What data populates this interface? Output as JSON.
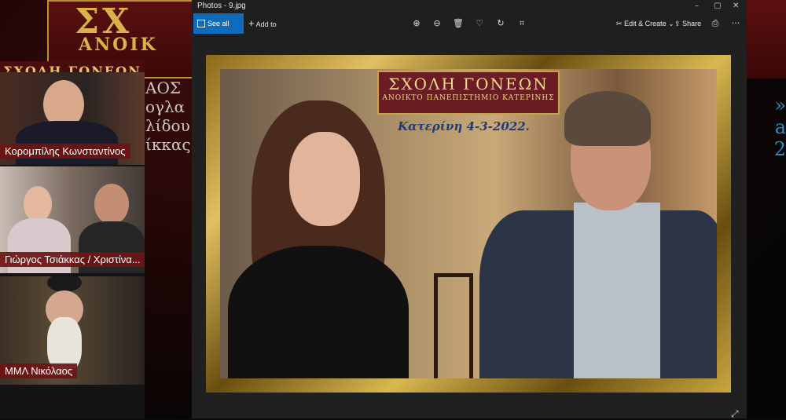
{
  "window": {
    "title": "Photos - 9.jpg",
    "controls": {
      "minimize": "–",
      "maximize": "▢",
      "close": "✕"
    }
  },
  "toolbar": {
    "see_all_photos": "See all photos",
    "add_to": "Add to",
    "edit_create": "Edit & Create",
    "share": "Share",
    "more": "···",
    "icons": [
      "zoom-in-icon",
      "zoom-out-icon",
      "delete-icon",
      "favorite-icon",
      "rotate-icon",
      "crop-icon",
      "print-icon"
    ]
  },
  "photo": {
    "badge_title": "ΣΧΟΛΗ ΓΟΝΕΩΝ",
    "badge_subtitle": "ΑΝΟΙΚΤΟ ΠΑΝΕΠΙΣΤΗΜΙΟ ΚΑΤΕΡΙΝΗΣ",
    "date": "Κατερίνη 4-3-2022."
  },
  "background": {
    "banner_title": "ΣΧ",
    "banner_sub": "ΑΝΟΙΚ",
    "left_lines": [
      "ΑΟΣ",
      "ογλα",
      "λίδου",
      "ίκκας"
    ],
    "right_lines": [
      "»",
      "a",
      "2"
    ]
  },
  "sidebar": {
    "title": "ΣΧΟΛΗ ΓΟΝΕΩΝ",
    "participants": [
      {
        "name": "Κορομπίλης Κωνσταντίνος"
      },
      {
        "name": "Γιώργος Τσιάκκας / Χριστίνα..."
      },
      {
        "name": "ΜΜΛ Νικόλαος"
      }
    ]
  },
  "colors": {
    "accent": "#0f6cbd",
    "frame_gold": "#c9a640",
    "badge_red": "#6a1d24",
    "name_tag": "#6e1414"
  }
}
